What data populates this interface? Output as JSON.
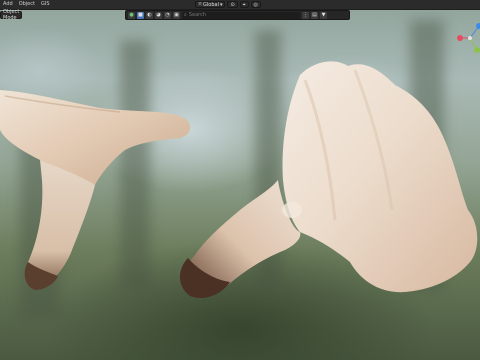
{
  "header": {
    "menu": [
      "Add",
      "Object",
      "GIS"
    ]
  },
  "mode": {
    "label": "Object Mode"
  },
  "toolbar": {
    "orientation": "Global",
    "search_placeholder": "Search",
    "filter_icon": "filter-icon"
  },
  "colors": {
    "header_bg": "#2b2b2b",
    "active_button": "#4772b3",
    "gizmo_x": "#e84a5f",
    "gizmo_y": "#8bc34a",
    "gizmo_z": "#3c8ce7"
  }
}
